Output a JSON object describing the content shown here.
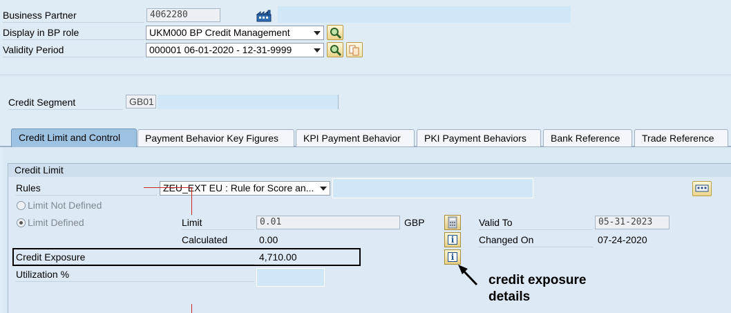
{
  "header": {
    "bp_label": "Business Partner",
    "bp_value": "4062280",
    "role_label": "Display in BP role",
    "role_value": "UKM000 BP Credit Management",
    "validity_label": "Validity Period",
    "validity_value": "000001 06-01-2020 - 12-31-9999"
  },
  "segment": {
    "label": "Credit Segment",
    "value": "GB01"
  },
  "tabs": [
    {
      "label": "Credit Limit and Control",
      "active": true
    },
    {
      "label": "Payment Behavior Key Figures"
    },
    {
      "label": "KPI Payment Behavior"
    },
    {
      "label": "PKI Payment Behaviors"
    },
    {
      "label": "Bank Reference"
    },
    {
      "label": "Trade Reference"
    }
  ],
  "credit_limit": {
    "title": "Credit Limit",
    "rules_label": "Rules",
    "rules_value": "ZEU_EXT EU : Rule for Score an...",
    "limit_not_defined": "Limit Not Defined",
    "limit_defined": "Limit Defined",
    "limit_label": "Limit",
    "limit_value": "0.01",
    "currency": "GBP",
    "calculated_label": "Calculated",
    "calculated_value": "0.00",
    "exposure_label": "Credit Exposure",
    "exposure_value": "4,710.00",
    "utilization_label": "Utilization %",
    "valid_to_label": "Valid To",
    "valid_to_value": "05-31-2023",
    "changed_on_label": "Changed On",
    "changed_on_value": "07-24-2020"
  },
  "annotation": {
    "line1": "credit exposure",
    "line2": "details"
  },
  "colors": {
    "background": "#dfebf5",
    "active_tab": "#9ec2e2",
    "highlight_field": "#cfe7f7",
    "annotation_red": "#cc2222"
  }
}
